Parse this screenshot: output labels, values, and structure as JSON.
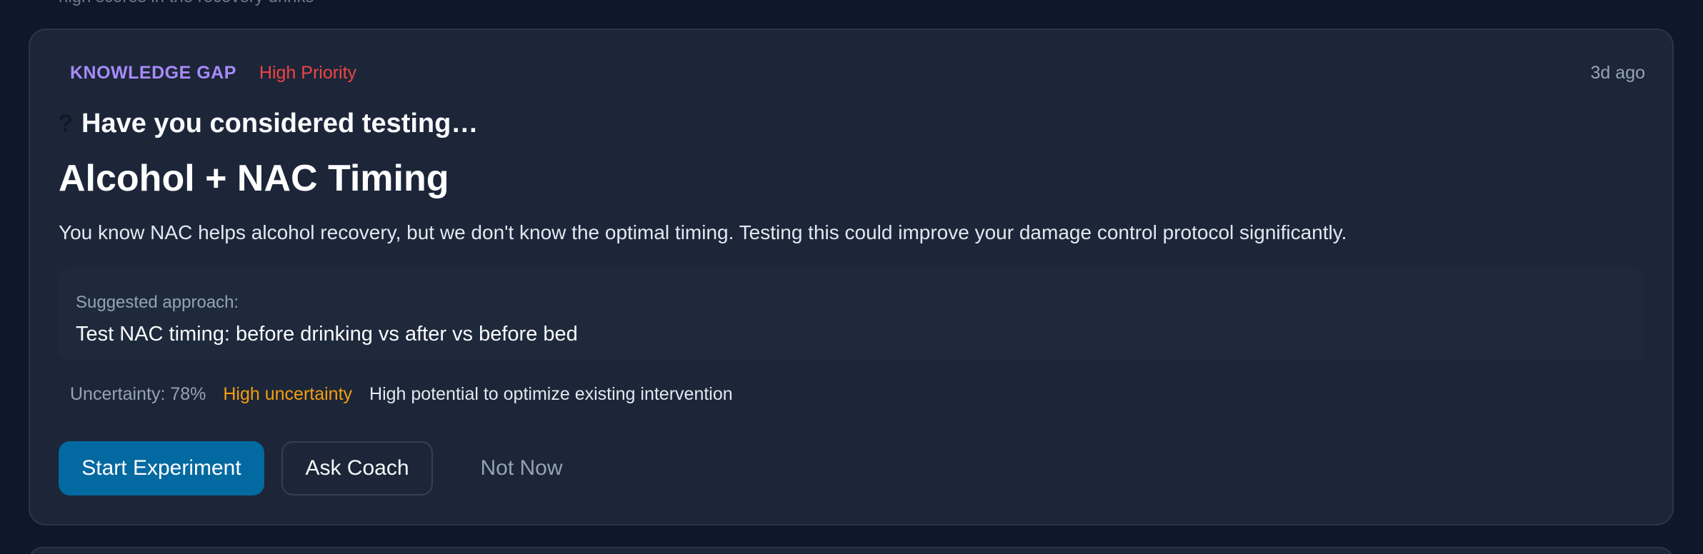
{
  "top_fragment": "high scores in the recovery drinks",
  "card": {
    "category": "KNOWLEDGE GAP",
    "priority": "High Priority",
    "timestamp": "3d ago",
    "prompt_icon": "question-icon",
    "prompt": "Have you considered testing…",
    "title": "Alcohol + NAC Timing",
    "description": "You know NAC helps alcohol recovery, but we don't know the optimal timing. Testing this could improve your damage control protocol significantly.",
    "approach": {
      "label": "Suggested approach:",
      "text": "Test NAC timing: before drinking vs after vs before bed"
    },
    "stats": {
      "uncertainty": "Uncertainty: 78%",
      "uncertainty_level": "High uncertainty",
      "potential": "High potential to optimize existing intervention"
    },
    "actions": {
      "primary": "Start Experiment",
      "secondary": "Ask Coach",
      "dismiss": "Not Now"
    }
  },
  "colors": {
    "background": "#0f172a",
    "card": "#1c2638",
    "category": "#a78bfa",
    "priority": "#ef4444",
    "uncertainty_level": "#f59e0b",
    "primary_button": "#0369a1"
  }
}
